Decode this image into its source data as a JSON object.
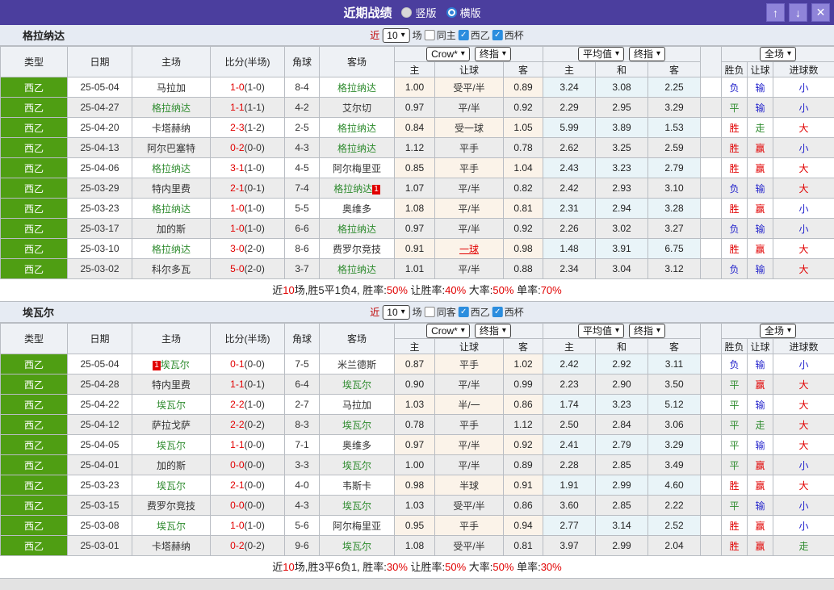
{
  "title_bar": {
    "title": "近期战绩",
    "vertical_label": "竖版",
    "vertical_selected": false,
    "horizontal_label": "横版",
    "horizontal_selected": true,
    "up_glyph": "↑",
    "down_glyph": "↓",
    "close_glyph": "✕"
  },
  "table_header": {
    "type": "类型",
    "date": "日期",
    "home": "主场",
    "score": "比分(半场)",
    "corner": "角球",
    "away": "客场",
    "crow_select": "Crow*",
    "final_select": "终指",
    "avg_select": "平均值",
    "full_select": "全场",
    "odds_home": "主",
    "odds_handicap": "让球",
    "odds_away": "客",
    "avg_home": "主",
    "avg_draw": "和",
    "avg_away": "客",
    "result_wdl": "胜负",
    "result_handicap": "让球",
    "result_goals": "进球数"
  },
  "colors": {
    "titlebar_bg": "#4b3e9e",
    "titlebar_button_bg": "#8f84d9",
    "band_bg": "#e6ebf3",
    "type_cell_bg": "#4f9e13",
    "row_alt_bg": "#ececec",
    "crow_col_bg": "#fbf3e9",
    "avg_col_bg": "#e9f4f8",
    "focus_team": "#2e8b2e",
    "red": "#e10000",
    "blue": "#2525cc",
    "green": "#2e8b2e",
    "border": "#b9bdc3",
    "check_blue": "#2b8dde",
    "result_colors": {
      "胜": "#e10000",
      "赢": "#e10000",
      "大": "#e10000",
      "平": "#2e8b2e",
      "走": "#2e8b2e",
      "负": "#2525cc",
      "输": "#2525cc",
      "小": "#2525cc"
    }
  },
  "sections": [
    {
      "team": "格拉纳达",
      "filter": {
        "near_label": "近",
        "matches_value": "10",
        "matches_label": "场",
        "same_label": "同主",
        "same_checked": false,
        "league_label": "西乙",
        "league_checked": true,
        "cup_label": "西杯",
        "cup_checked": true
      },
      "rows": [
        {
          "league": "西乙",
          "date": "25-05-04",
          "home": {
            "name": "马拉加"
          },
          "score_full": "1-0",
          "score_half": "(1-0)",
          "corners": "8-4",
          "away": {
            "name": "格拉纳达",
            "focused": true
          },
          "crow": [
            "1.00",
            "受平/半",
            "0.89"
          ],
          "handicap_highlight": false,
          "average": [
            "3.24",
            "3.08",
            "2.25"
          ],
          "result": [
            "负",
            "输",
            "小"
          ]
        },
        {
          "league": "西乙",
          "date": "25-04-27",
          "home": {
            "name": "格拉纳达",
            "focused": true
          },
          "score_full": "1-1",
          "score_half": "(1-1)",
          "corners": "4-2",
          "away": {
            "name": "艾尔切"
          },
          "crow": [
            "0.97",
            "平/半",
            "0.92"
          ],
          "handicap_highlight": false,
          "average": [
            "2.29",
            "2.95",
            "3.29"
          ],
          "result": [
            "平",
            "输",
            "小"
          ]
        },
        {
          "league": "西乙",
          "date": "25-04-20",
          "home": {
            "name": "卡塔赫纳"
          },
          "score_full": "2-3",
          "score_half": "(1-2)",
          "corners": "2-5",
          "away": {
            "name": "格拉纳达",
            "focused": true
          },
          "crow": [
            "0.84",
            "受一球",
            "1.05"
          ],
          "handicap_highlight": false,
          "average": [
            "5.99",
            "3.89",
            "1.53"
          ],
          "result": [
            "胜",
            "走",
            "大"
          ]
        },
        {
          "league": "西乙",
          "date": "25-04-13",
          "home": {
            "name": "阿尔巴塞特"
          },
          "score_full": "0-2",
          "score_half": "(0-0)",
          "corners": "4-3",
          "away": {
            "name": "格拉纳达",
            "focused": true
          },
          "crow": [
            "1.12",
            "平手",
            "0.78"
          ],
          "handicap_highlight": false,
          "average": [
            "2.62",
            "3.25",
            "2.59"
          ],
          "result": [
            "胜",
            "赢",
            "小"
          ]
        },
        {
          "league": "西乙",
          "date": "25-04-06",
          "home": {
            "name": "格拉纳达",
            "focused": true
          },
          "score_full": "3-1",
          "score_half": "(1-0)",
          "corners": "4-5",
          "away": {
            "name": "阿尔梅里亚"
          },
          "crow": [
            "0.85",
            "平手",
            "1.04"
          ],
          "handicap_highlight": false,
          "average": [
            "2.43",
            "3.23",
            "2.79"
          ],
          "result": [
            "胜",
            "赢",
            "大"
          ]
        },
        {
          "league": "西乙",
          "date": "25-03-29",
          "home": {
            "name": "特内里费"
          },
          "score_full": "2-1",
          "score_half": "(0-1)",
          "corners": "7-4",
          "away": {
            "name": "格拉纳达",
            "focused": true,
            "badge": "1",
            "badge_position": "after"
          },
          "crow": [
            "1.07",
            "平/半",
            "0.82"
          ],
          "handicap_highlight": false,
          "average": [
            "2.42",
            "2.93",
            "3.10"
          ],
          "result": [
            "负",
            "输",
            "大"
          ]
        },
        {
          "league": "西乙",
          "date": "25-03-23",
          "home": {
            "name": "格拉纳达",
            "focused": true
          },
          "score_full": "1-0",
          "score_half": "(1-0)",
          "corners": "5-5",
          "away": {
            "name": "奥维多"
          },
          "crow": [
            "1.08",
            "平/半",
            "0.81"
          ],
          "handicap_highlight": false,
          "average": [
            "2.31",
            "2.94",
            "3.28"
          ],
          "result": [
            "胜",
            "赢",
            "小"
          ]
        },
        {
          "league": "西乙",
          "date": "25-03-17",
          "home": {
            "name": "加的斯"
          },
          "score_full": "1-0",
          "score_half": "(1-0)",
          "corners": "6-6",
          "away": {
            "name": "格拉纳达",
            "focused": true
          },
          "crow": [
            "0.97",
            "平/半",
            "0.92"
          ],
          "handicap_highlight": false,
          "average": [
            "2.26",
            "3.02",
            "3.27"
          ],
          "result": [
            "负",
            "输",
            "小"
          ]
        },
        {
          "league": "西乙",
          "date": "25-03-10",
          "home": {
            "name": "格拉纳达",
            "focused": true
          },
          "score_full": "3-0",
          "score_half": "(2-0)",
          "corners": "8-6",
          "away": {
            "name": "费罗尔竞技"
          },
          "crow": [
            "0.91",
            "一球",
            "0.98"
          ],
          "handicap_highlight": true,
          "average": [
            "1.48",
            "3.91",
            "6.75"
          ],
          "result": [
            "胜",
            "赢",
            "大"
          ]
        },
        {
          "league": "西乙",
          "date": "25-03-02",
          "home": {
            "name": "科尔多瓦"
          },
          "score_full": "5-0",
          "score_half": "(2-0)",
          "corners": "3-7",
          "away": {
            "name": "格拉纳达",
            "focused": true
          },
          "crow": [
            "1.01",
            "平/半",
            "0.88"
          ],
          "handicap_highlight": false,
          "average": [
            "2.34",
            "3.04",
            "3.12"
          ],
          "result": [
            "负",
            "输",
            "大"
          ]
        }
      ],
      "summary": [
        {
          "text": "近",
          "red": false
        },
        {
          "text": "10",
          "red": true
        },
        {
          "text": "场,胜5平1负4, 胜率:",
          "red": false
        },
        {
          "text": "50%",
          "red": true
        },
        {
          "text": " 让胜率:",
          "red": false
        },
        {
          "text": "40%",
          "red": true
        },
        {
          "text": " 大率:",
          "red": false
        },
        {
          "text": "50%",
          "red": true
        },
        {
          "text": " 单率:",
          "red": false
        },
        {
          "text": "70%",
          "red": true
        }
      ]
    },
    {
      "team": "埃瓦尔",
      "filter": {
        "near_label": "近",
        "matches_value": "10",
        "matches_label": "场",
        "same_label": "同客",
        "same_checked": false,
        "league_label": "西乙",
        "league_checked": true,
        "cup_label": "西杯",
        "cup_checked": true
      },
      "rows": [
        {
          "league": "西乙",
          "date": "25-05-04",
          "home": {
            "name": "埃瓦尔",
            "focused": true,
            "badge": "1",
            "badge_position": "before"
          },
          "score_full": "0-1",
          "score_half": "(0-0)",
          "corners": "7-5",
          "away": {
            "name": "米兰德斯"
          },
          "crow": [
            "0.87",
            "平手",
            "1.02"
          ],
          "handicap_highlight": false,
          "average": [
            "2.42",
            "2.92",
            "3.11"
          ],
          "result": [
            "负",
            "输",
            "小"
          ]
        },
        {
          "league": "西乙",
          "date": "25-04-28",
          "home": {
            "name": "特内里费"
          },
          "score_full": "1-1",
          "score_half": "(0-1)",
          "corners": "6-4",
          "away": {
            "name": "埃瓦尔",
            "focused": true
          },
          "crow": [
            "0.90",
            "平/半",
            "0.99"
          ],
          "handicap_highlight": false,
          "average": [
            "2.23",
            "2.90",
            "3.50"
          ],
          "result": [
            "平",
            "赢",
            "大"
          ]
        },
        {
          "league": "西乙",
          "date": "25-04-22",
          "home": {
            "name": "埃瓦尔",
            "focused": true
          },
          "score_full": "2-2",
          "score_half": "(1-0)",
          "corners": "2-7",
          "away": {
            "name": "马拉加"
          },
          "crow": [
            "1.03",
            "半/一",
            "0.86"
          ],
          "handicap_highlight": false,
          "average": [
            "1.74",
            "3.23",
            "5.12"
          ],
          "result": [
            "平",
            "输",
            "大"
          ]
        },
        {
          "league": "西乙",
          "date": "25-04-12",
          "home": {
            "name": "萨拉戈萨"
          },
          "score_full": "2-2",
          "score_half": "(0-2)",
          "corners": "8-3",
          "away": {
            "name": "埃瓦尔",
            "focused": true
          },
          "crow": [
            "0.78",
            "平手",
            "1.12"
          ],
          "handicap_highlight": false,
          "average": [
            "2.50",
            "2.84",
            "3.06"
          ],
          "result": [
            "平",
            "走",
            "大"
          ]
        },
        {
          "league": "西乙",
          "date": "25-04-05",
          "home": {
            "name": "埃瓦尔",
            "focused": true
          },
          "score_full": "1-1",
          "score_half": "(0-0)",
          "corners": "7-1",
          "away": {
            "name": "奥维多"
          },
          "crow": [
            "0.97",
            "平/半",
            "0.92"
          ],
          "handicap_highlight": false,
          "average": [
            "2.41",
            "2.79",
            "3.29"
          ],
          "result": [
            "平",
            "输",
            "大"
          ]
        },
        {
          "league": "西乙",
          "date": "25-04-01",
          "home": {
            "name": "加的斯"
          },
          "score_full": "0-0",
          "score_half": "(0-0)",
          "corners": "3-3",
          "away": {
            "name": "埃瓦尔",
            "focused": true
          },
          "crow": [
            "1.00",
            "平/半",
            "0.89"
          ],
          "handicap_highlight": false,
          "average": [
            "2.28",
            "2.85",
            "3.49"
          ],
          "result": [
            "平",
            "赢",
            "小"
          ]
        },
        {
          "league": "西乙",
          "date": "25-03-23",
          "home": {
            "name": "埃瓦尔",
            "focused": true
          },
          "score_full": "2-1",
          "score_half": "(0-0)",
          "corners": "4-0",
          "away": {
            "name": "韦斯卡"
          },
          "crow": [
            "0.98",
            "半球",
            "0.91"
          ],
          "handicap_highlight": false,
          "average": [
            "1.91",
            "2.99",
            "4.60"
          ],
          "result": [
            "胜",
            "赢",
            "大"
          ]
        },
        {
          "league": "西乙",
          "date": "25-03-15",
          "home": {
            "name": "费罗尔竞技"
          },
          "score_full": "0-0",
          "score_half": "(0-0)",
          "corners": "4-3",
          "away": {
            "name": "埃瓦尔",
            "focused": true
          },
          "crow": [
            "1.03",
            "受平/半",
            "0.86"
          ],
          "handicap_highlight": false,
          "average": [
            "3.60",
            "2.85",
            "2.22"
          ],
          "result": [
            "平",
            "输",
            "小"
          ]
        },
        {
          "league": "西乙",
          "date": "25-03-08",
          "home": {
            "name": "埃瓦尔",
            "focused": true
          },
          "score_full": "1-0",
          "score_half": "(1-0)",
          "corners": "5-6",
          "away": {
            "name": "阿尔梅里亚"
          },
          "crow": [
            "0.95",
            "平手",
            "0.94"
          ],
          "handicap_highlight": false,
          "average": [
            "2.77",
            "3.14",
            "2.52"
          ],
          "result": [
            "胜",
            "赢",
            "小"
          ]
        },
        {
          "league": "西乙",
          "date": "25-03-01",
          "home": {
            "name": "卡塔赫纳"
          },
          "score_full": "0-2",
          "score_half": "(0-2)",
          "corners": "9-6",
          "away": {
            "name": "埃瓦尔",
            "focused": true
          },
          "crow": [
            "1.08",
            "受平/半",
            "0.81"
          ],
          "handicap_highlight": false,
          "average": [
            "3.97",
            "2.99",
            "2.04"
          ],
          "result": [
            "胜",
            "赢",
            "走"
          ]
        }
      ],
      "summary": [
        {
          "text": "近",
          "red": false
        },
        {
          "text": "10",
          "red": true
        },
        {
          "text": "场,胜3平6负1, 胜率:",
          "red": false
        },
        {
          "text": "30%",
          "red": true
        },
        {
          "text": " 让胜率:",
          "red": false
        },
        {
          "text": "50%",
          "red": true
        },
        {
          "text": " 大率:",
          "red": false
        },
        {
          "text": "50%",
          "red": true
        },
        {
          "text": " 单率:",
          "red": false
        },
        {
          "text": "30%",
          "red": true
        }
      ]
    }
  ]
}
